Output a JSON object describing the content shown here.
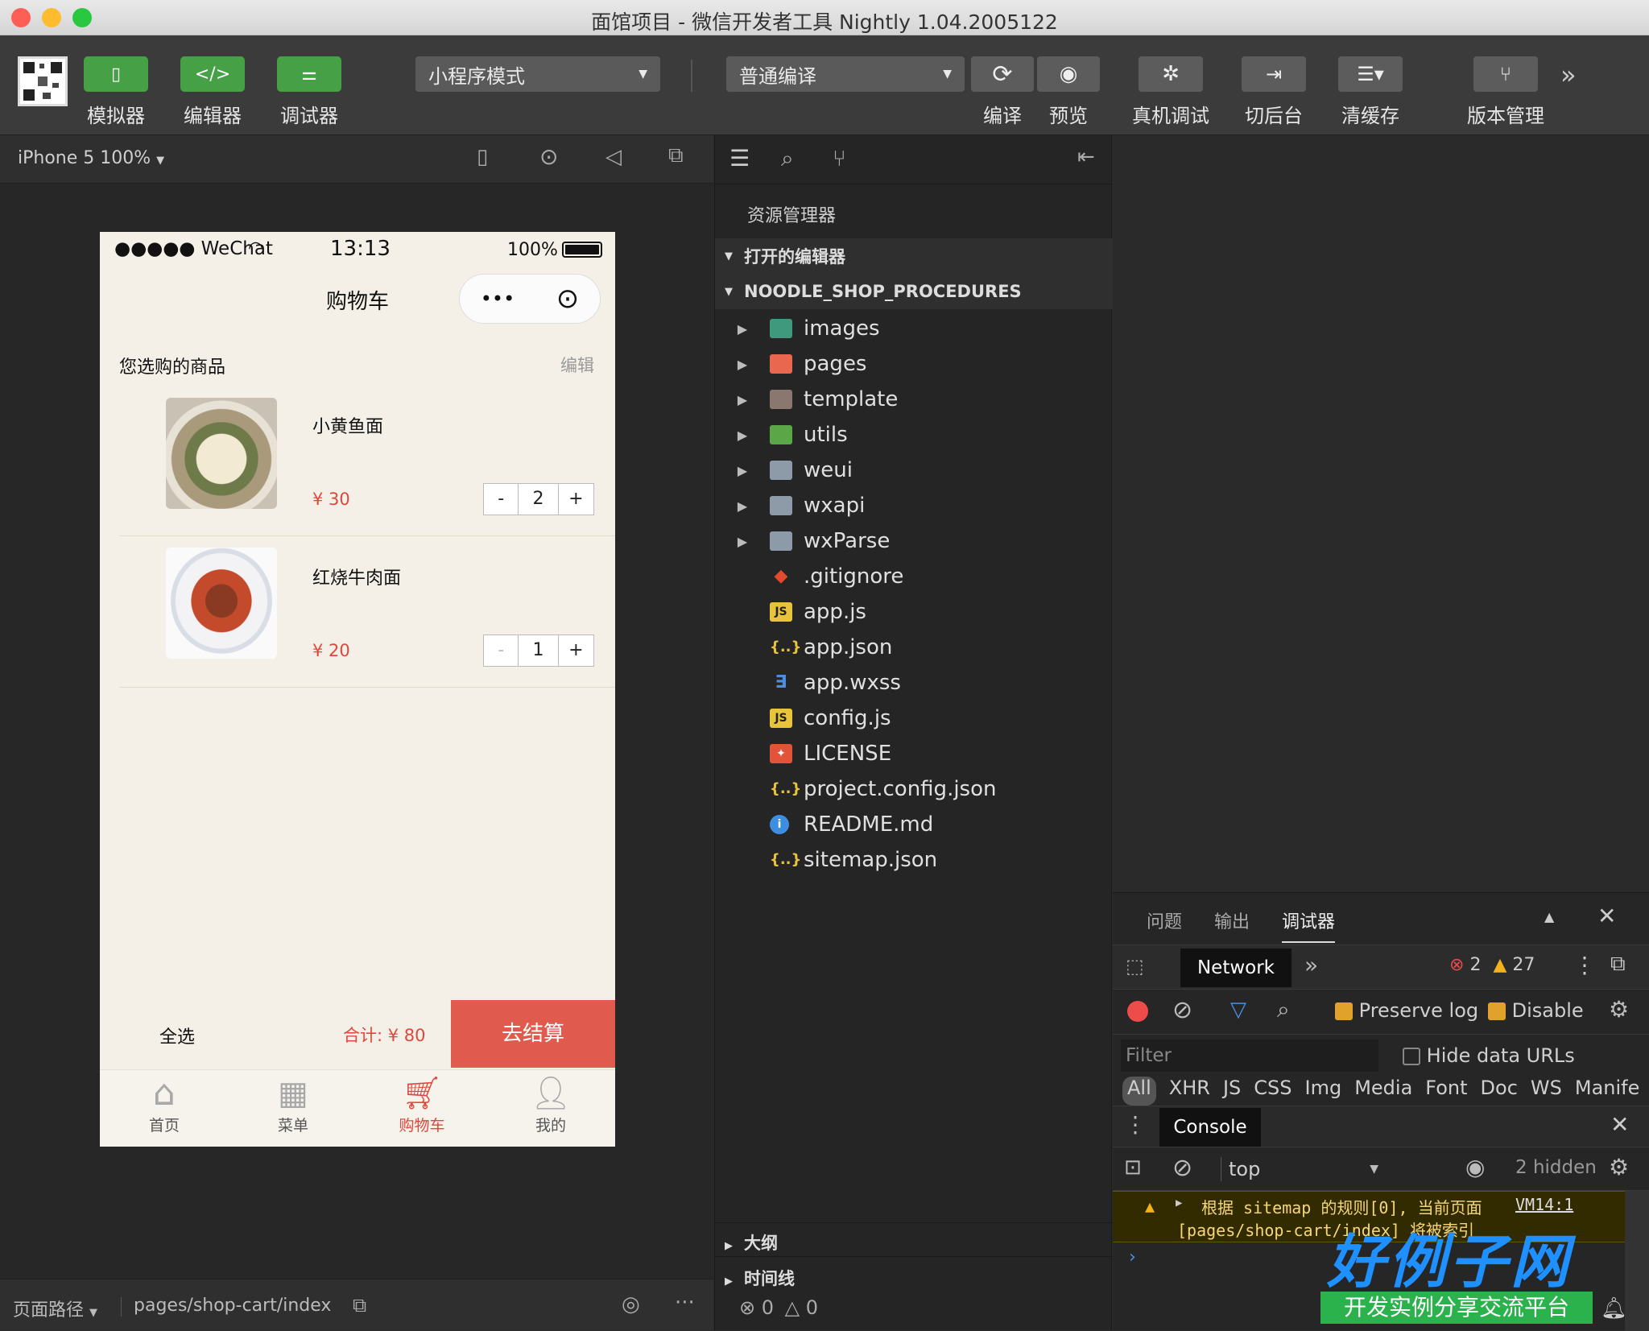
{
  "window": {
    "title": "面馆项目 - 微信开发者工具 Nightly 1.04.2005122"
  },
  "toolbar": {
    "simulator": "模拟器",
    "editor": "编辑器",
    "debugger": "调试器",
    "mode_select": "小程序模式",
    "compile_select": "普通编译",
    "compile": "编译",
    "preview": "预览",
    "remote_debug": "真机调试",
    "background": "切后台",
    "clear_cache": "清缓存",
    "version": "版本管理"
  },
  "simulator_bar": {
    "device": "iPhone 5 100%"
  },
  "phone": {
    "status": {
      "carrier": "●●●●● WeChat",
      "time": "13:13",
      "battery": "100%"
    },
    "nav_title": "购物车",
    "section_title": "您选购的商品",
    "edit": "编辑",
    "items": [
      {
        "name": "小黄鱼面",
        "price": "¥ 30",
        "qty": "2",
        "minus": "-",
        "plus": "+"
      },
      {
        "name": "红烧牛肉面",
        "price": "¥ 20",
        "qty": "1",
        "minus": "-",
        "plus": "+"
      }
    ],
    "select_all": "全选",
    "total": "合计: ¥ 80",
    "checkout": "去结算",
    "tabs": [
      "首页",
      "菜单",
      "购物车",
      "我的"
    ]
  },
  "bottombar": {
    "path_label": "页面路径",
    "path": "pages/shop-cart/index"
  },
  "explorer": {
    "title": "资源管理器",
    "open_editors": "打开的编辑器",
    "project": "NOODLE_SHOP_PROCEDURES",
    "folders": [
      "images",
      "pages",
      "template",
      "utils",
      "weui",
      "wxapi",
      "wxParse"
    ],
    "files": [
      ".gitignore",
      "app.js",
      "app.json",
      "app.wxss",
      "config.js",
      "LICENSE",
      "project.config.json",
      "README.md",
      "sitemap.json"
    ],
    "outline": "大纲",
    "timeline": "时间线",
    "status_errors": "0",
    "status_warnings": "0"
  },
  "devtools": {
    "tabs": [
      "问题",
      "输出",
      "调试器"
    ],
    "network_tab": "Network",
    "errors": "2",
    "warnings": "27",
    "preserve_log": "Preserve log",
    "disable_cache": "Disable",
    "filter_placeholder": "Filter",
    "hide_data_urls": "Hide data URLs",
    "types": [
      "All",
      "XHR",
      "JS",
      "CSS",
      "Img",
      "Media",
      "Font",
      "Doc",
      "WS",
      "Manife"
    ],
    "console_tab": "Console",
    "context": "top",
    "hidden": "2 hidden",
    "message_line1": "根据 sitemap 的规则[0], 当前页面",
    "message_link": "VM14:1",
    "message_line2": "[pages/shop-cart/index] 将被索引"
  },
  "watermark": {
    "main": "好例子网",
    "sub": "开发实例分享交流平台"
  }
}
